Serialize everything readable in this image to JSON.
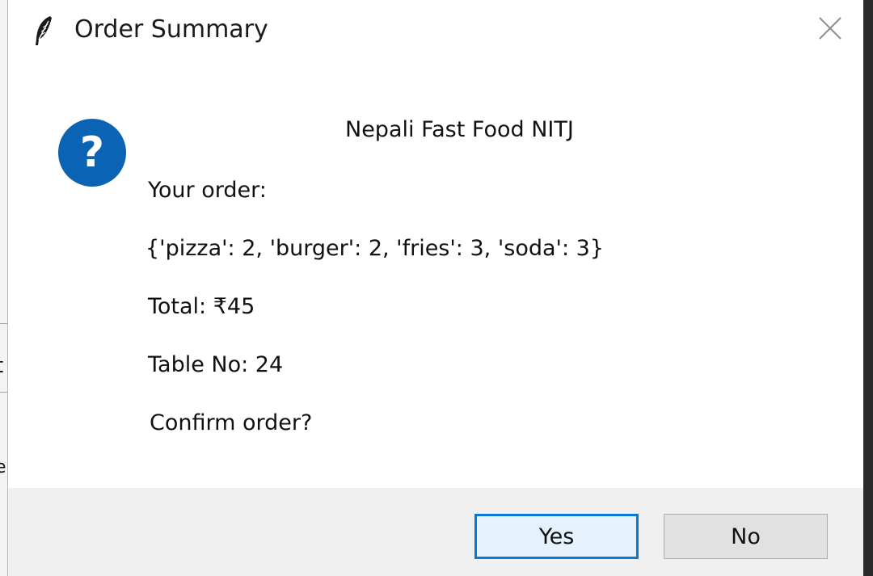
{
  "window": {
    "title": "Order Summary",
    "icon": "feather-icon",
    "close_icon": "close-icon"
  },
  "background_window": {
    "edge_glyph": "t",
    "edge_glyph_lower": "e"
  },
  "message": {
    "icon": "question-icon",
    "icon_glyph": "?",
    "icon_color": "#0a63b5",
    "heading": "Nepali Fast Food NITJ",
    "your_order_label": "Your order:",
    "order_items": "{'pizza': 2, 'burger': 2, 'fries': 3, 'soda': 3}",
    "total": "Total: ₹45",
    "table_no": "Table No: 24",
    "prompt": "Confirm order?"
  },
  "buttons": {
    "yes_label": "Yes",
    "no_label": "No",
    "focus_color": "#0a78d7"
  }
}
